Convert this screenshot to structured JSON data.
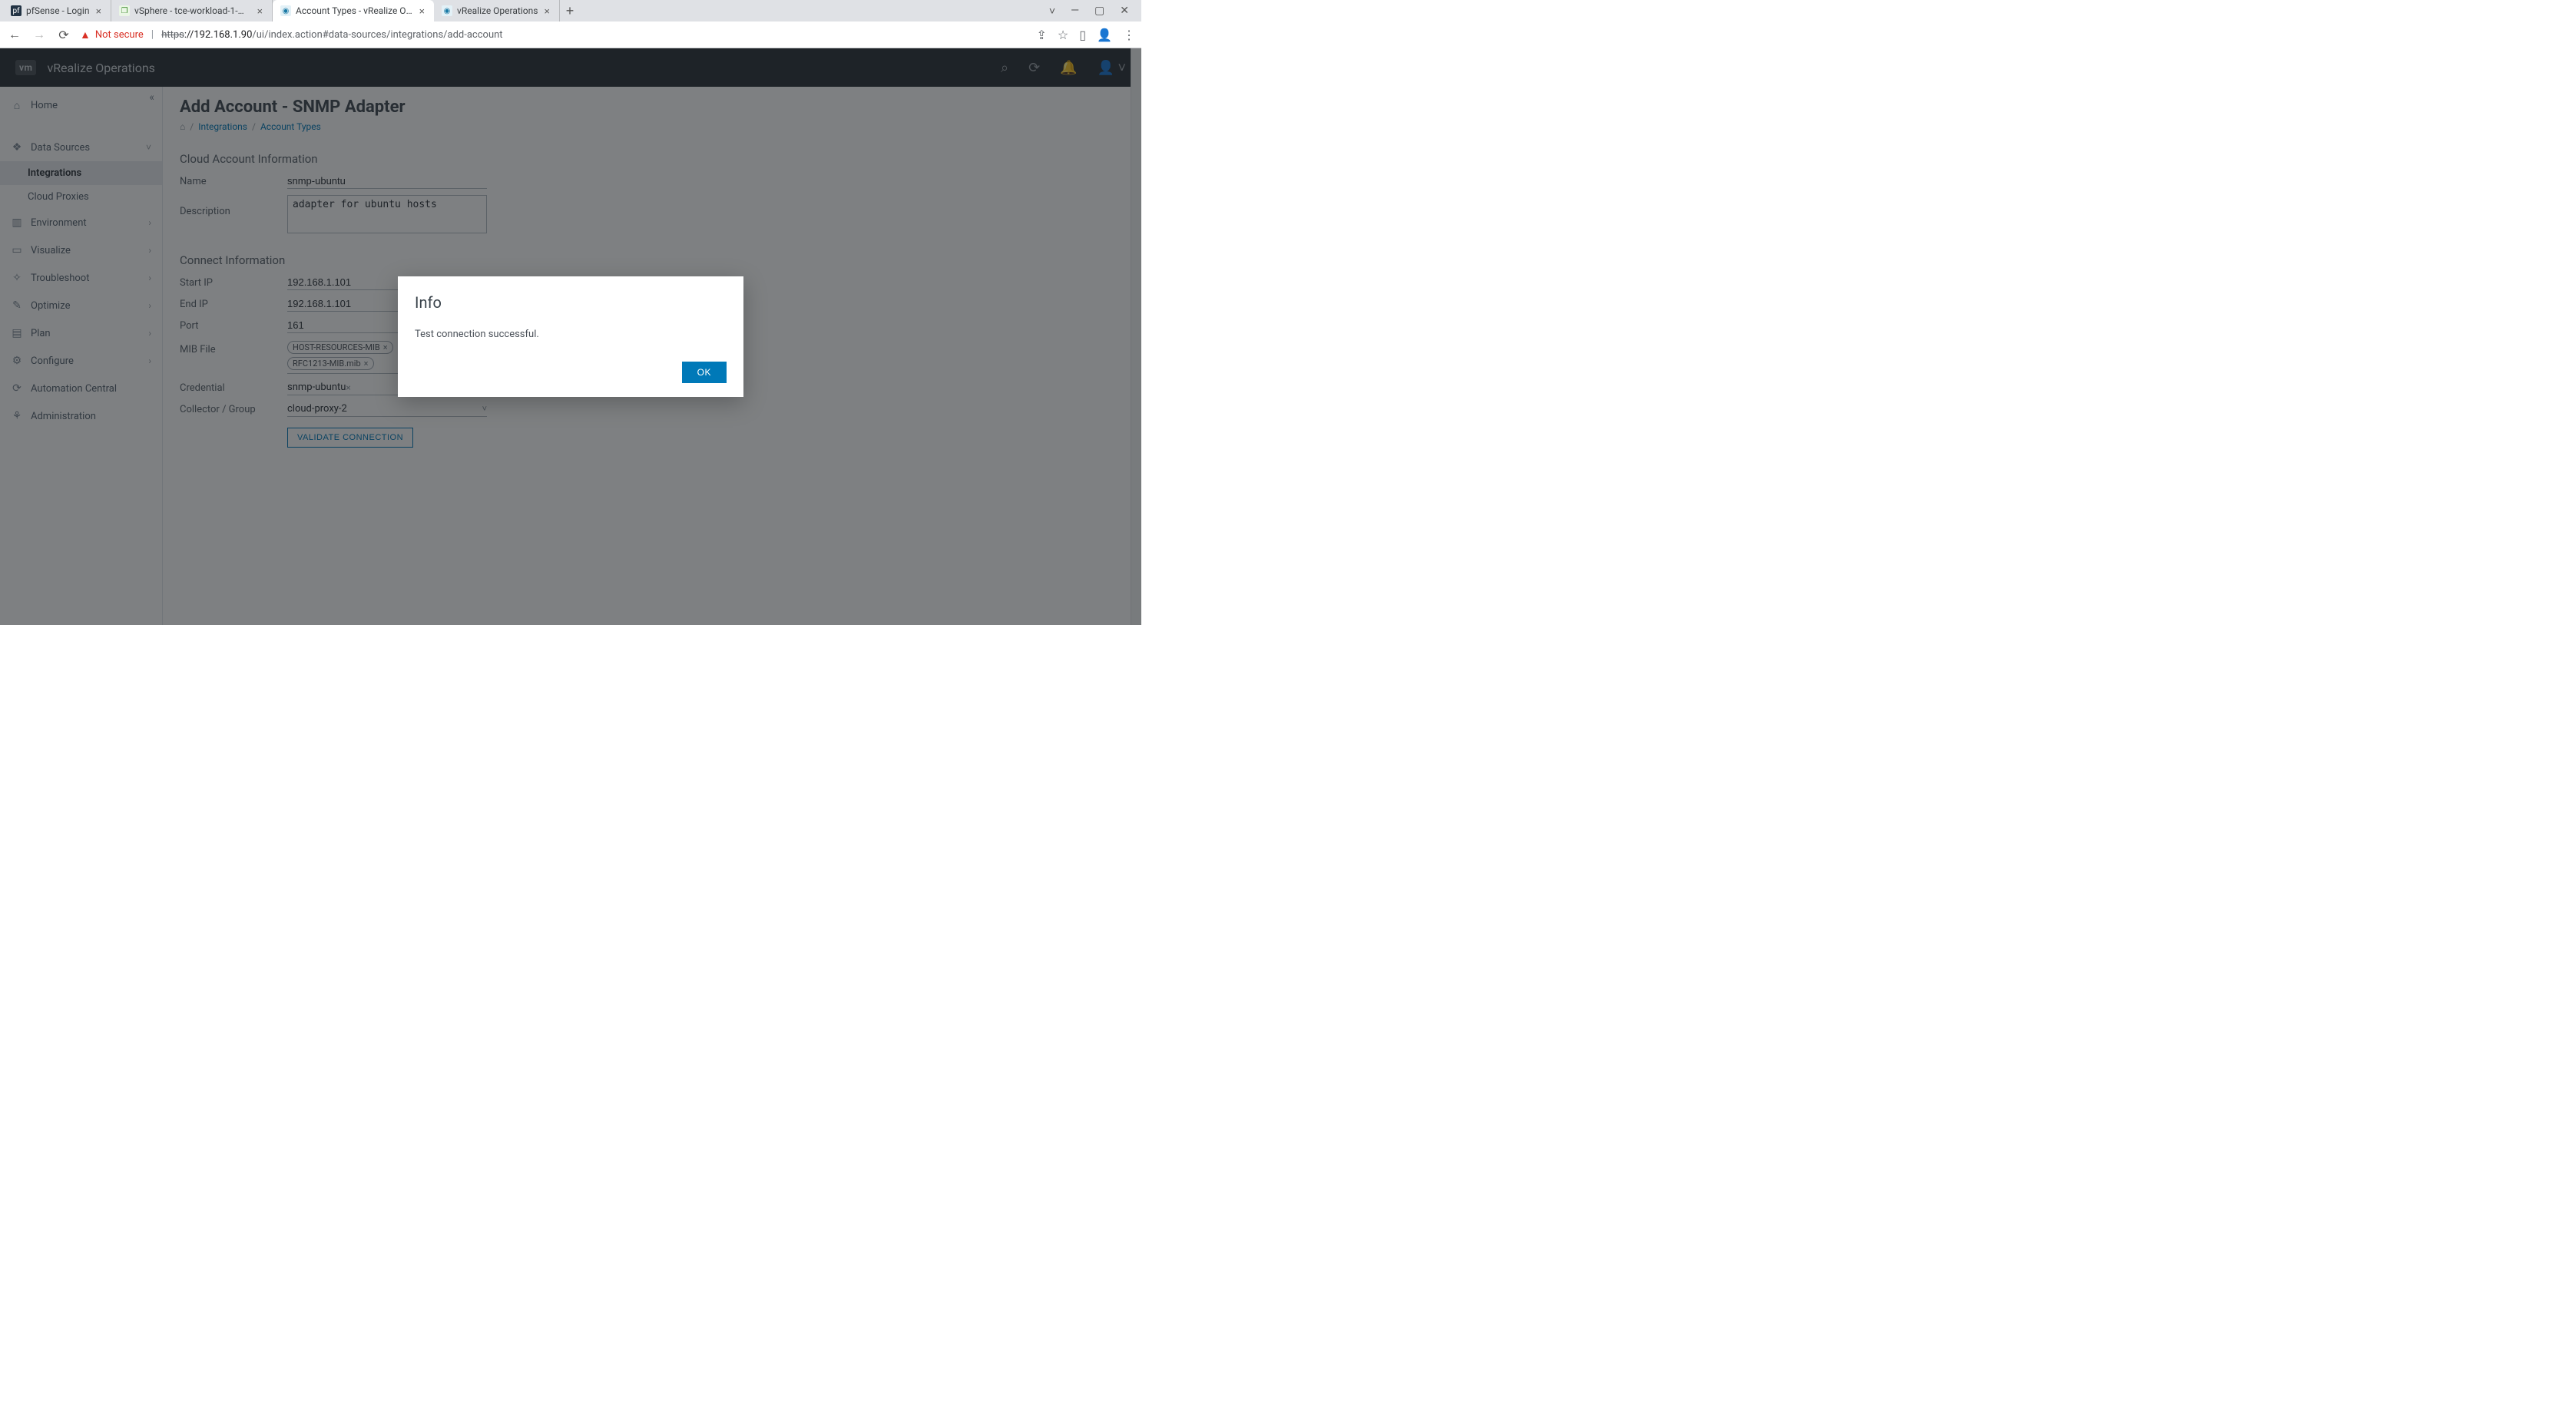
{
  "browser": {
    "tabs": [
      {
        "favicon_bg": "#234",
        "favicon_txt": "pf",
        "title": "pfSense - Login"
      },
      {
        "favicon_bg": "#6bbf4b",
        "favicon_txt": "❐",
        "title": "vSphere - tce-workload-1-md-2-"
      },
      {
        "favicon_bg": "#2196c9",
        "favicon_txt": "◉",
        "title": "Account Types - vRealize Operati"
      },
      {
        "favicon_bg": "#2196c9",
        "favicon_txt": "◉",
        "title": "vRealize Operations"
      }
    ],
    "active_tab_index": 2,
    "security_text": "Not secure",
    "url_scheme": "https",
    "url_host": "://192.168.1.90",
    "url_path": "/ui/index.action#data-sources/integrations/add-account"
  },
  "header": {
    "logo": "vm",
    "product": "vRealize Operations"
  },
  "sidebar": {
    "items": [
      {
        "icon": "⌂",
        "label": "Home",
        "chev": ""
      },
      {
        "icon": "❖",
        "label": "Data Sources",
        "chev": "˅",
        "children": [
          {
            "label": "Integrations",
            "active": true
          },
          {
            "label": "Cloud Proxies",
            "active": false
          }
        ]
      },
      {
        "icon": "▥",
        "label": "Environment",
        "chev": "›"
      },
      {
        "icon": "▭",
        "label": "Visualize",
        "chev": "›"
      },
      {
        "icon": "✧",
        "label": "Troubleshoot",
        "chev": "›"
      },
      {
        "icon": "✎",
        "label": "Optimize",
        "chev": "›"
      },
      {
        "icon": "▤",
        "label": "Plan",
        "chev": "›"
      },
      {
        "icon": "⚙",
        "label": "Configure",
        "chev": "›"
      },
      {
        "icon": "⟳",
        "label": "Automation Central",
        "chev": ""
      },
      {
        "icon": "⚘",
        "label": "Administration",
        "chev": ""
      }
    ]
  },
  "page": {
    "title": "Add Account - SNMP Adapter",
    "breadcrumbs": {
      "link1": "Integrations",
      "link2": "Account Types"
    },
    "section1": "Cloud Account Information",
    "section2": "Connect Information",
    "labels": {
      "name": "Name",
      "desc": "Description",
      "startip": "Start IP",
      "endip": "End IP",
      "port": "Port",
      "mib": "MIB File",
      "cred": "Credential",
      "collector": "Collector / Group"
    },
    "fields": {
      "name": "snmp-ubuntu",
      "desc": "adapter for ubuntu hosts",
      "startip": "192.168.1.101",
      "endip": "192.168.1.101",
      "port": "161",
      "mib_tags": [
        "HOST-RESOURCES-MIB",
        "RFC1213-MIB.mib"
      ],
      "cred": "snmp-ubuntu",
      "collector": "cloud-proxy-2"
    },
    "validate_label": "VALIDATE CONNECTION"
  },
  "modal": {
    "title": "Info",
    "message": "Test connection successful.",
    "ok": "OK"
  }
}
